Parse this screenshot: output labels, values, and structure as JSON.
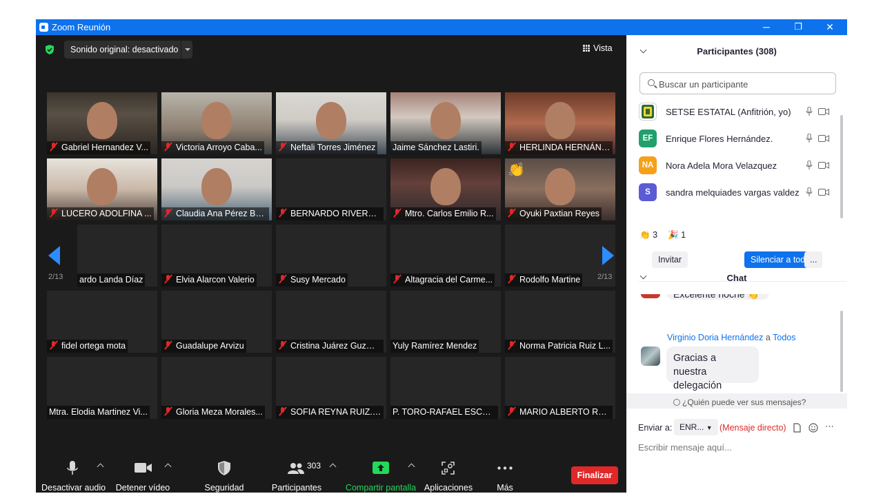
{
  "window": {
    "title": "Zoom Reunión",
    "controls": {
      "minimize": "─",
      "restore": "❐",
      "close": "✕"
    }
  },
  "meeting": {
    "sound_original": "Sonido original: desactivado",
    "view_label": "Vista",
    "page_indicator": "2/13",
    "tiles": [
      {
        "name": "Gabriel Hernandez V...",
        "muted": true,
        "video": true
      },
      {
        "name": "Victoria Arroyo Caba...",
        "muted": true,
        "video": true
      },
      {
        "name": "Neftali Torres Jiménez",
        "muted": true,
        "video": true
      },
      {
        "name": "Jaime Sánchez Lastiri.",
        "muted": false,
        "video": true
      },
      {
        "name": "HERLINDA HERNÁND...",
        "muted": true,
        "video": true
      },
      {
        "name": "LUCERO ADOLFINA ...",
        "muted": true,
        "video": true
      },
      {
        "name": "Claudia Ana Pérez Bu...",
        "muted": true,
        "video": true
      },
      {
        "name": "BERNARDO RIVERA C...",
        "muted": true,
        "video": false
      },
      {
        "name": "Mtro. Carlos Emilio R...",
        "muted": true,
        "video": true
      },
      {
        "name": "Oyuki Paxtian Reyes",
        "muted": true,
        "video": true,
        "reaction": "👏"
      },
      {
        "name": "ardo Landa Díaz",
        "muted": false,
        "video": false
      },
      {
        "name": "Elvia Alarcon Valerio",
        "muted": true,
        "video": false
      },
      {
        "name": "Susy Mercado",
        "muted": true,
        "video": false
      },
      {
        "name": "Altagracia del Carme...",
        "muted": true,
        "video": false
      },
      {
        "name": "Rodolfo Martine",
        "muted": true,
        "video": false
      },
      {
        "name": "fidel ortega mota",
        "muted": true,
        "video": false
      },
      {
        "name": "Guadalupe Arvizu",
        "muted": true,
        "video": false
      },
      {
        "name": "Cristina Juárez Guzmán",
        "muted": true,
        "video": false
      },
      {
        "name": "Yuly Ramírez Mendez",
        "muted": false,
        "video": false
      },
      {
        "name": "Norma Patricia Ruiz L...",
        "muted": true,
        "video": false
      },
      {
        "name": "Mtra. Elodia Martinez Vi...",
        "muted": false,
        "video": false
      },
      {
        "name": "Gloria Meza Morales...",
        "muted": true,
        "video": false
      },
      {
        "name": "SOFIA REYNA RUIZ.TE...",
        "muted": true,
        "video": false
      },
      {
        "name": "P. TORO-RAFAEL ESCOB...",
        "muted": false,
        "video": false
      },
      {
        "name": "MARIO ALBERTO REY...",
        "muted": true,
        "video": false
      }
    ]
  },
  "toolbar": {
    "mute_audio": "Desactivar audio",
    "stop_video": "Detener vídeo",
    "security": "Seguridad",
    "participants": "Participantes",
    "participants_count": "303",
    "share_screen": "Compartir pantalla",
    "apps": "Aplicaciones",
    "more": "Más",
    "end": "Finalizar"
  },
  "participants_panel": {
    "title": "Participantes (308)",
    "search_placeholder": "Buscar un participante",
    "list": [
      {
        "initials": "",
        "name": "SETSE ESTATAL (Anfitrión, yo)",
        "color": "#ffffff"
      },
      {
        "initials": "EF",
        "name": "Enrique Flores Hernández.",
        "color": "#21a06c"
      },
      {
        "initials": "NA",
        "name": "Nora Adela Mora Velazquez",
        "color": "#f5a01a"
      },
      {
        "initials": "S",
        "name": "sandra melquiades vargas valdez",
        "color": "#5b5bd6"
      }
    ],
    "reactions": [
      {
        "emoji": "👏",
        "count": "3"
      },
      {
        "emoji": "🎉",
        "count": "1"
      }
    ],
    "invite": "Invitar",
    "mute_all": "Silenciar a todos",
    "more": "..."
  },
  "chat": {
    "title": "Chat",
    "partial_message": "Excelente noche 👏",
    "message": {
      "sender": "Virginio Doria Hernández",
      "to_word": "a",
      "recipient": "Todos",
      "text_line1": "Gracias a nuestra",
      "text_line2": "delegación"
    },
    "who_can_see": "¿Quién puede ver sus mensajes?",
    "send_to_label": "Enviar a:",
    "send_to_value": "ENR...",
    "direct_message": "(Mensaje directo)",
    "input_placeholder": "Escribir mensaje aquí..."
  },
  "colors": {
    "accent": "#0e72ed",
    "end_red": "#e02828",
    "share_green": "#23d959",
    "link_blue": "#0e72ed"
  }
}
